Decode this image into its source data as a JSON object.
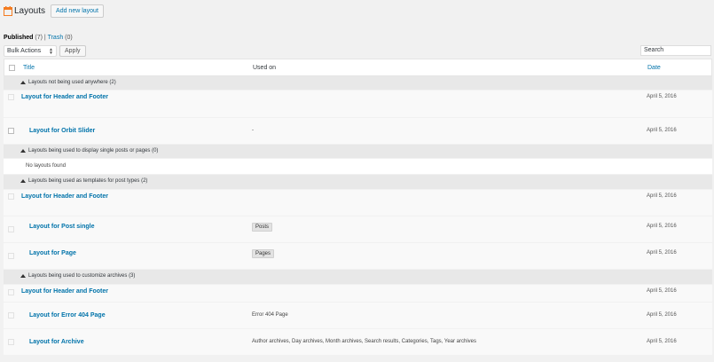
{
  "header": {
    "title": "Layouts",
    "add_new_label": "Add new layout",
    "logo_color": "#f47b20"
  },
  "filters": {
    "published_label": "Published",
    "published_count": "(7)",
    "separator": "|",
    "trash_label": "Trash",
    "trash_count": "(0)"
  },
  "tablenav": {
    "bulk_actions": "Bulk Actions",
    "apply_label": "Apply",
    "search_value": "Search"
  },
  "table": {
    "columns": {
      "title": "Title",
      "used_on": "Used on",
      "date": "Date"
    },
    "groups": [
      {
        "label": "Layouts not being used anywhere (2)",
        "items": [
          {
            "title": "Layout for Header and Footer",
            "used_on": "",
            "date": "April 5, 2016"
          },
          {
            "title": "Layout for Orbit Slider",
            "used_on": "-",
            "date": "April 5, 2016"
          }
        ]
      },
      {
        "label": "Layouts being used to display single posts or pages (0)",
        "empty": "No layouts found"
      },
      {
        "label": "Layouts being used as templates for post types (2)",
        "items": [
          {
            "title": "Layout for Header and Footer",
            "used_on": "",
            "date": "April 5, 2016"
          },
          {
            "title": "Layout for Post single",
            "used_on": "Posts",
            "date": "April 5, 2016"
          },
          {
            "title": "Layout for Page",
            "used_on": "Pages",
            "date": "April 5, 2016"
          }
        ]
      },
      {
        "label": "Layouts being used to customize archives (3)",
        "items": [
          {
            "title": "Layout for Header and Footer",
            "used_on": "",
            "date": "April 5, 2016"
          },
          {
            "title": "Layout for Error 404 Page",
            "used_on": "Error 404 Page",
            "date": "April 5, 2016"
          },
          {
            "title": "Layout for Archive",
            "used_on": "Author archives, Day archives, Month archives, Search results, Categories, Tags, Year archives",
            "date": "April 5, 2016"
          }
        ]
      }
    ]
  },
  "colors": {
    "link": "#0073aa",
    "group_bg": "#e8e8e8",
    "row_bg": "#f9f9f9"
  }
}
